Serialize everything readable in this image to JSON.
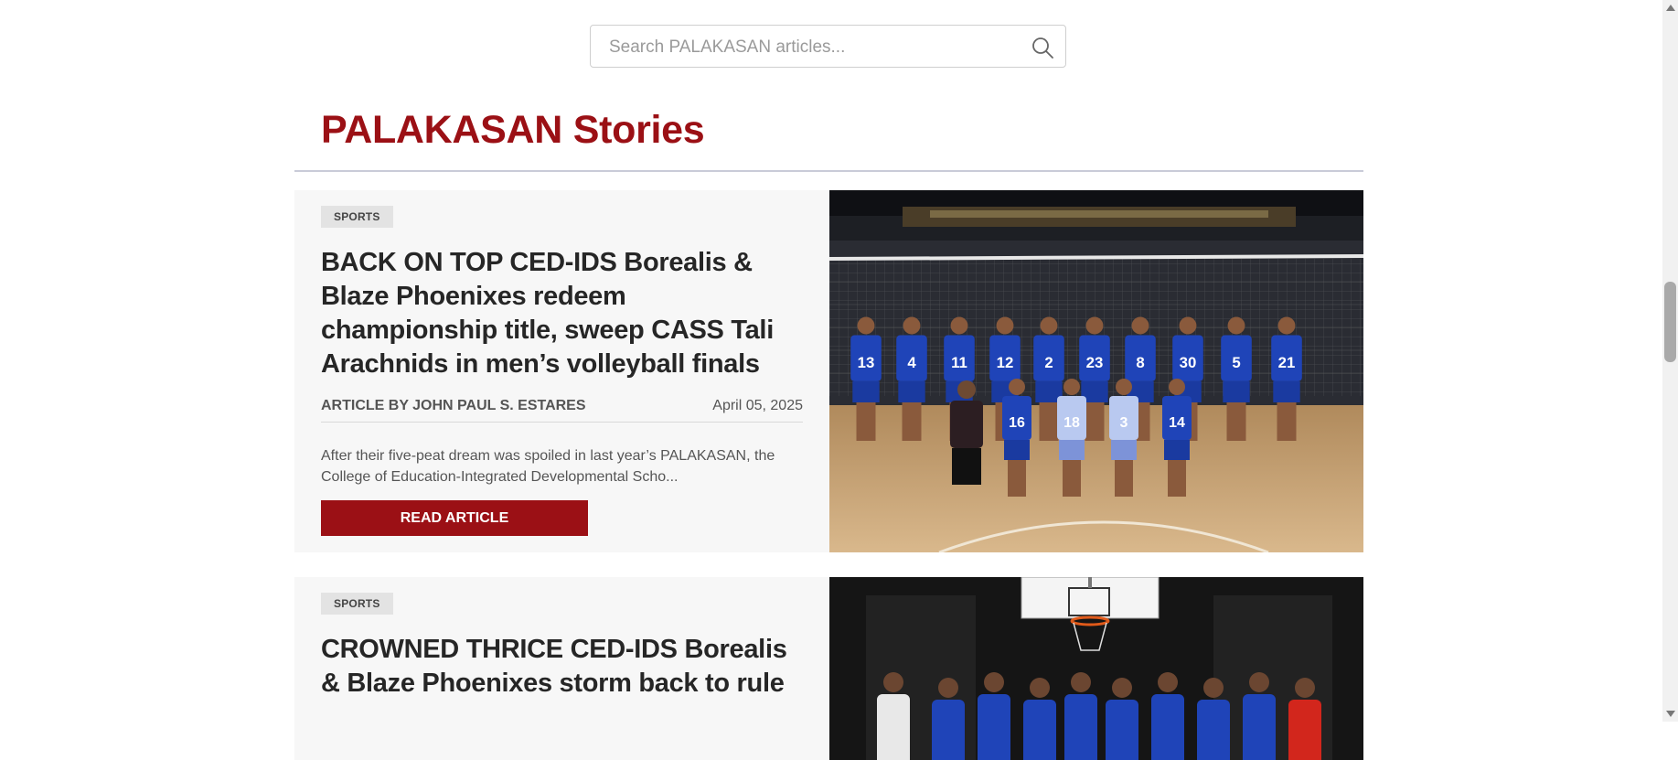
{
  "search": {
    "placeholder": "Search PALAKASAN articles..."
  },
  "section": {
    "title": "PALAKASAN Stories"
  },
  "articles": [
    {
      "category": "SPORTS",
      "headline": "BACK ON TOP CED-IDS Borealis & Blaze Phoenixes redeem championship title, sweep CASS Tali Arachnids in men’s volleyball finals",
      "byline": "ARTICLE BY JOHN PAUL S. ESTARES",
      "date": "April 05, 2025",
      "excerpt": "After their five-peat dream was spoiled in last year’s PALAKASAN, the College of Education-Integrated Developmental Scho...",
      "button_label": "READ ARTICLE",
      "jersey_numbers": [
        "13",
        "4",
        "11",
        "12",
        "2",
        "23",
        "8",
        "30",
        "5",
        "21",
        "16",
        "18",
        "3",
        "14"
      ]
    },
    {
      "category": "SPORTS",
      "headline": "CROWNED THRICE CED-IDS Borealis & Blaze Phoenixes storm back to rule"
    }
  ],
  "colors": {
    "accent": "#9b1015",
    "card_bg": "#f7f7f7",
    "jersey": "#1f44b8"
  }
}
